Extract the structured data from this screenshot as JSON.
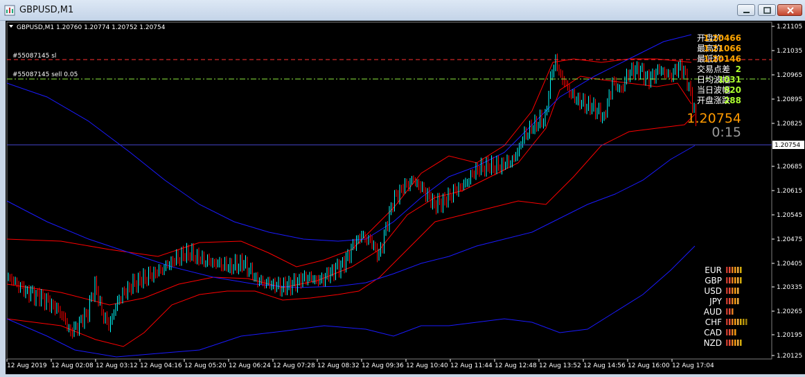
{
  "window": {
    "title": "GBPUSD,M1",
    "minimize_icon": "minimize-icon",
    "maximize_icon": "maximize-icon",
    "close_icon": "close-icon",
    "app_icon": "chart-icon"
  },
  "chart": {
    "header": "GBPUSD,M1  1.20760 1.20774 1.20752 1.20754",
    "order_labels": [
      "#55087145 sl",
      "#55087145 sell 0.05"
    ],
    "current_price_label": "1.20754",
    "big_price": "1.20754",
    "countdown": "0:15",
    "colors": {
      "background": "#000000",
      "bull_candle": "#00ffff",
      "bear_candle": "#ff0000",
      "band_red": "#ff0000",
      "band_blue": "#1a1aff",
      "sl_line": "#ff3030",
      "order_line": "#90ee40",
      "price_line": "#4444cc",
      "info_value": "#ffa500",
      "info_value_green": "#adff2f",
      "big_price": "#ff9a00",
      "countdown": "#9a9a9a"
    }
  },
  "price_axis": [
    "1.21105",
    "1.21035",
    "1.20965",
    "1.20895",
    "1.20825",
    "1.20685",
    "1.20615",
    "1.20545",
    "1.20475",
    "1.20405",
    "1.20335",
    "1.20265",
    "1.20195",
    "1.20125"
  ],
  "time_axis": [
    "12 Aug 2019",
    "12 Aug 02:08",
    "12 Aug 03:12",
    "12 Aug 04:16",
    "12 Aug 05:20",
    "12 Aug 06:24",
    "12 Aug 07:28",
    "12 Aug 08:32",
    "12 Aug 09:36",
    "12 Aug 10:40",
    "12 Aug 11:44",
    "12 Aug 12:48",
    "12 Aug 13:52",
    "12 Aug 14:56",
    "12 Aug 16:00",
    "12 Aug 17:04"
  ],
  "info_panel": [
    {
      "label": "开盘价",
      "value": "1.20466",
      "color": "#ffa500"
    },
    {
      "label": "最高价",
      "value": "1.21066",
      "color": "#ffa500"
    },
    {
      "label": "最低价",
      "value": "1.20146",
      "color": "#ffa500"
    },
    {
      "label": "交易点差",
      "value": "2",
      "color": "#adff2f"
    },
    {
      "label": "日均波幅",
      "value": "1031",
      "color": "#adff2f"
    },
    {
      "label": "当日波幅",
      "value": "920",
      "color": "#adff2f"
    },
    {
      "label": "开盘涨跌",
      "value": "288",
      "color": "#adff2f"
    }
  ],
  "currency_strength": [
    {
      "code": "EUR",
      "bars": 6
    },
    {
      "code": "GBP",
      "bars": 6
    },
    {
      "code": "USD",
      "bars": 5
    },
    {
      "code": "JPY",
      "bars": 5
    },
    {
      "code": "AUD",
      "bars": 3
    },
    {
      "code": "CHF",
      "bars": 8
    },
    {
      "code": "CAD",
      "bars": 4
    },
    {
      "code": "NZD",
      "bars": 6
    }
  ]
}
